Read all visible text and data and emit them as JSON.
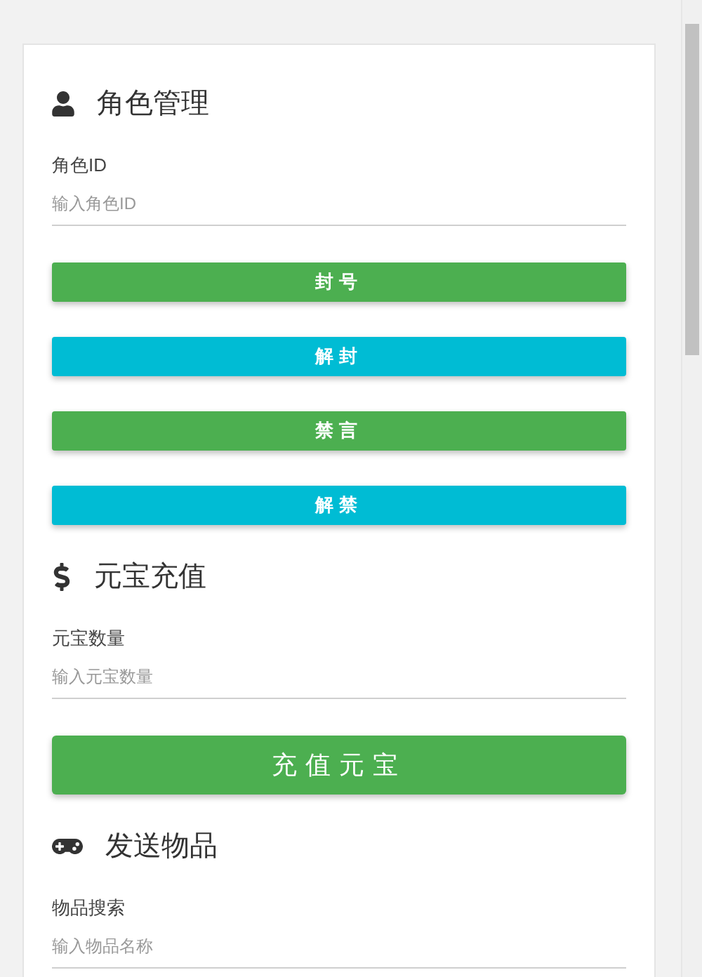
{
  "sections": [
    {
      "kind": "user",
      "title": "角色管理",
      "field": {
        "label": "角色ID",
        "placeholder": "输入角色ID"
      },
      "buttons": [
        {
          "label": "封号",
          "color": "#4caf50",
          "kind": "normal"
        },
        {
          "label": "解封",
          "color": "#00bcd4",
          "kind": "normal"
        },
        {
          "label": "禁言",
          "color": "#4caf50",
          "kind": "normal"
        },
        {
          "label": "解禁",
          "color": "#00bcd4",
          "kind": "normal"
        }
      ]
    },
    {
      "kind": "dollar",
      "title": "元宝充值",
      "field": {
        "label": "元宝数量",
        "placeholder": "输入元宝数量"
      },
      "buttons": [
        {
          "label": "充值元宝",
          "color": "#4caf50",
          "kind": "large"
        }
      ]
    },
    {
      "kind": "gamepad",
      "title": "发送物品",
      "field": {
        "label": "物品搜索",
        "placeholder": "输入物品名称"
      }
    }
  ]
}
